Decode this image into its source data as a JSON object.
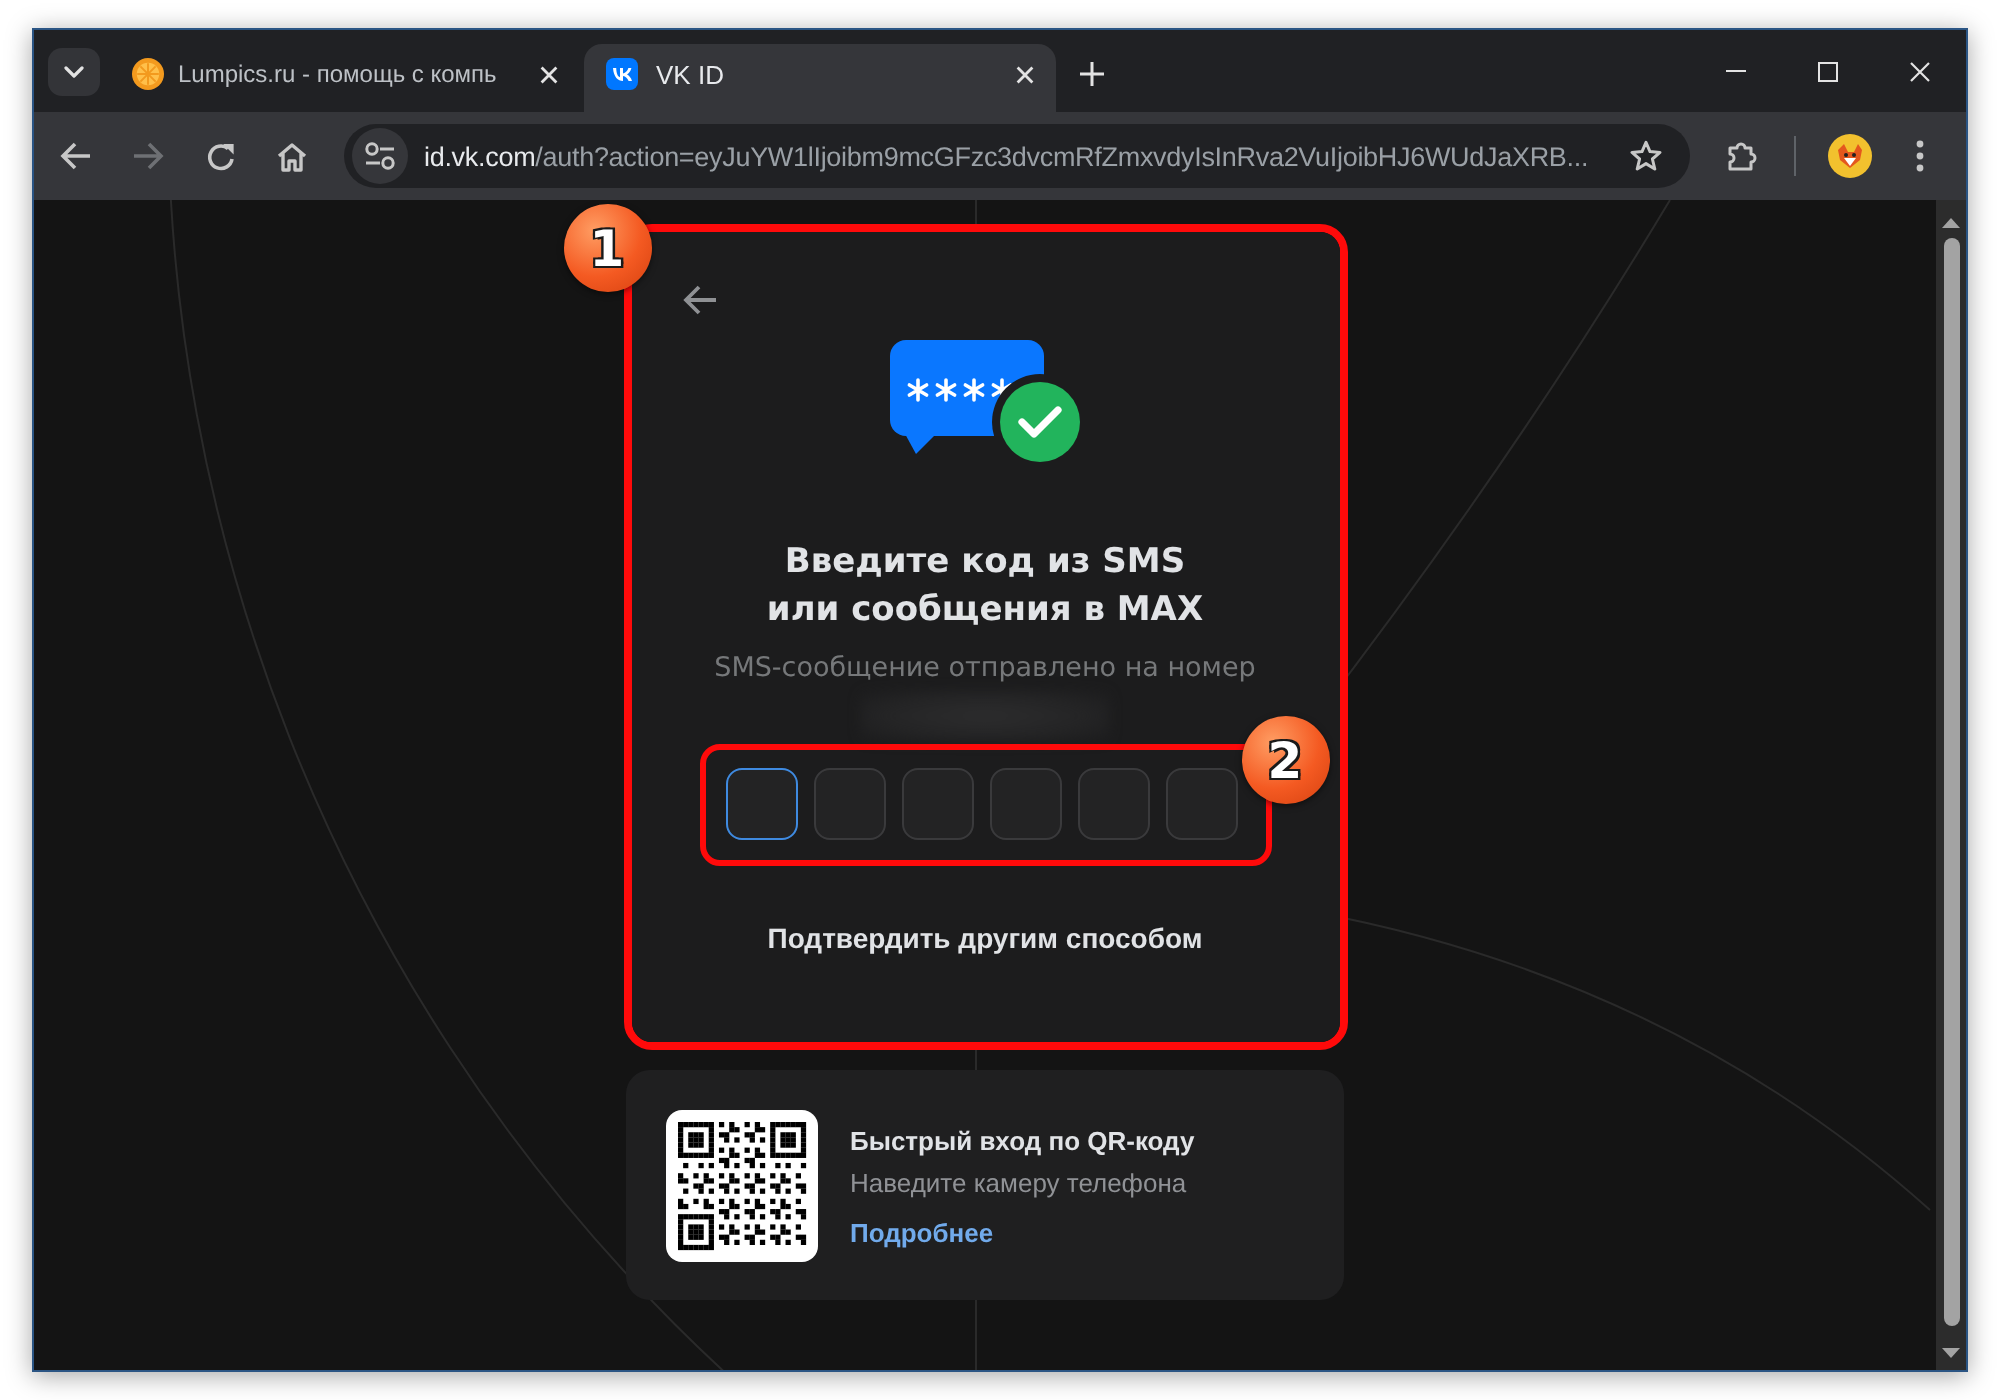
{
  "browser": {
    "tabs": [
      {
        "title": "Lumpics.ru - помощь с компь",
        "selected": false
      },
      {
        "title": "VK ID",
        "selected": true
      }
    ],
    "forward_disabled": true,
    "address": {
      "host": "id.vk.com",
      "rest": "/auth?action=eyJuYW1lIjoibm9mcGFzc3dvcmRfZmxvdyIsInRva2VuIjoibHJ6WUdJaXRB..."
    }
  },
  "code_card": {
    "title_lines": [
      "Введите код из SMS",
      "или сообщения в MAX"
    ],
    "subtitle": "SMS-сообщение отправлено на номер",
    "code_cells": [
      {
        "focused": true
      },
      {
        "focused": false
      },
      {
        "focused": false
      },
      {
        "focused": false
      },
      {
        "focused": false
      },
      {
        "focused": false
      }
    ],
    "alt_action": "Подтвердить другим способом"
  },
  "qr_card": {
    "title": "Быстрый вход по QR-коду",
    "description": "Наведите камеру телефона",
    "link": "Подробнее"
  },
  "annotations": [
    {
      "label": "1"
    },
    {
      "label": "2"
    }
  ]
}
